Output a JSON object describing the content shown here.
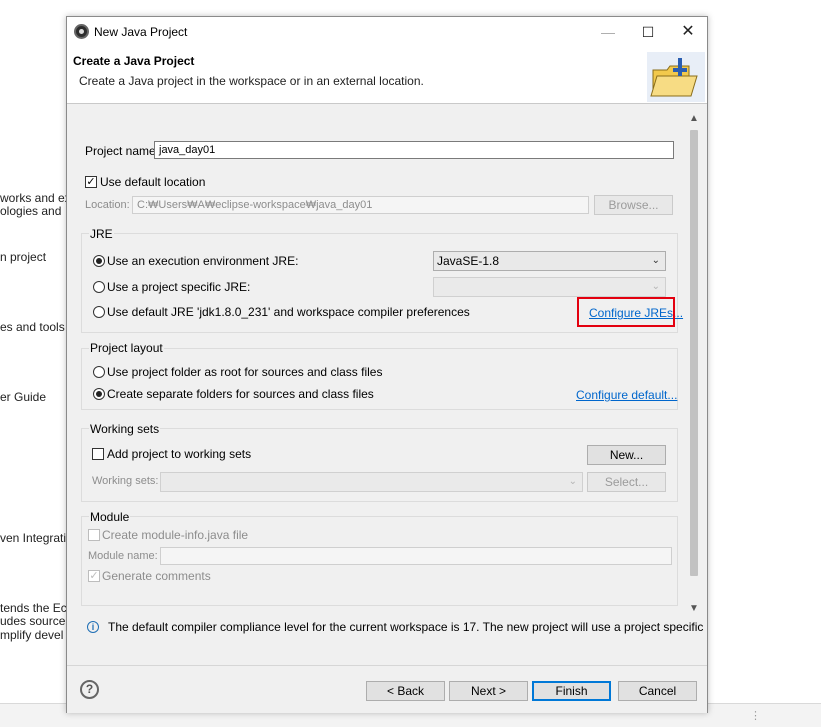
{
  "background": {
    "lines": [
      "works and ex",
      "ologies and",
      "n project",
      "es and tools",
      "er Guide",
      "ven Integrati",
      "tends the Ec",
      "udes source",
      "mplify devel"
    ],
    "status_dots": "⋮"
  },
  "window": {
    "title": "New Java Project",
    "minimize": "—",
    "maximize": "☐",
    "close": "✕"
  },
  "header": {
    "title": "Create a Java Project",
    "subtitle": "Create a Java project in the workspace or in an external location."
  },
  "form": {
    "project_name_label": "Project name:",
    "project_name_value": "java_day01",
    "use_default_location_label": "Use default location",
    "use_default_location_checked": true,
    "location_label": "Location:",
    "location_value": "C:₩Users₩A₩eclipse-workspace₩java_day01",
    "browse_label": "Browse..."
  },
  "jre": {
    "group_label": "JRE",
    "option_env_label": "Use an execution environment JRE:",
    "env_selected": "JavaSE-1.8",
    "option_specific_label": "Use a project specific JRE:",
    "option_default_label": "Use default JRE 'jdk1.8.0_231' and workspace compiler preferences",
    "configure_jres_link": "Configure JREs...",
    "selected_option": "execution-environment"
  },
  "project_layout": {
    "group_label": "Project layout",
    "option_root_label": "Use project folder as root for sources and class files",
    "option_separate_label": "Create separate folders for sources and class files",
    "configure_default_link": "Configure default...",
    "selected_option": "separate-folders"
  },
  "working_sets": {
    "group_label": "Working sets",
    "add_label": "Add project to working sets",
    "new_label": "New...",
    "working_sets_label": "Working sets:",
    "select_label": "Select..."
  },
  "module": {
    "group_label": "Module",
    "create_module_info_label": "Create module-info.java file",
    "module_name_label": "Module name:",
    "generate_comments_label": "Generate comments",
    "generate_comments_checked": true
  },
  "info_message": "The default compiler compliance level for the current workspace is 17. The new project will use a project specific",
  "footer": {
    "help": "?",
    "back_label": "< Back",
    "next_label": "Next >",
    "finish_label": "Finish",
    "cancel_label": "Cancel"
  },
  "colors": {
    "highlight": "#e3000f",
    "link": "#0066cc",
    "default_button_border": "#0078d7"
  }
}
